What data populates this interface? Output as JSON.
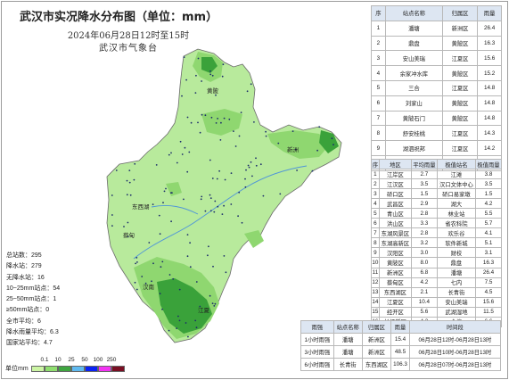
{
  "title": "武汉市实况降水分布图（单位：mm）",
  "subtitle": "2024年06月28日12时至15时",
  "org": "武汉市气象台",
  "stats": [
    "总站数：295",
    "降水站：279",
    "无降水站：16",
    "10~25mm站点：54",
    "25~50mm站点：1",
    "≥50mm站点：0",
    "全市平均：6",
    "降水雨量平均：6.3",
    "国家站平均：4.7"
  ],
  "legend": {
    "unit": "单位mm",
    "ticks": [
      "0.1",
      "10",
      "25",
      "50",
      "100",
      "250"
    ],
    "colors": [
      "#ccf5a4",
      "#8fde6f",
      "#3fa640",
      "#5fbaf0",
      "#0a22f5",
      "#f233f2",
      "#7a0f23"
    ]
  },
  "map": {
    "colors": {
      "light": "#b8ea9c",
      "mid": "#8fd770",
      "dark": "#3aa23a",
      "boundary": "#6b6b6b",
      "river": "#4f95d8"
    },
    "places": [
      "新洲",
      "黄陂",
      "蔡甸",
      "汉南",
      "江夏",
      "东西湖"
    ]
  },
  "top_table": {
    "headers": [
      "序",
      "站点名称",
      "归属区",
      "雨量"
    ],
    "rows": [
      [
        "1",
        "潘塘",
        "新洲区",
        "26.4"
      ],
      [
        "2",
        "鼎盘",
        "黄陂区",
        "16.3"
      ],
      [
        "3",
        "安山美瑞",
        "江夏区",
        "15.6"
      ],
      [
        "4",
        "余家冲水库",
        "黄陂区",
        "15.2"
      ],
      [
        "5",
        "三合",
        "江夏区",
        "14.8"
      ],
      [
        "6",
        "刘家山",
        "黄陂区",
        "14.8"
      ],
      [
        "7",
        "黄陂石门",
        "黄陂区",
        "14.8"
      ],
      [
        "8",
        "舒安桂桃",
        "江夏区",
        "14.3"
      ],
      [
        "9",
        "湖泗祝邦",
        "江夏区",
        "14.2"
      ],
      [
        "10",
        "沿湖",
        "江夏区",
        "14.0"
      ]
    ]
  },
  "district_table": {
    "headers": [
      "序",
      "地区",
      "平均雨量",
      "极值站名",
      "极值雨量"
    ],
    "rows": [
      [
        "1",
        "江岸区",
        "2.7",
        "江滩",
        "3.8"
      ],
      [
        "2",
        "江汉区",
        "3.5",
        "汉口文体中心",
        "3.5"
      ],
      [
        "3",
        "硚口区",
        "1.5",
        "硚口易家墩",
        "1.5"
      ],
      [
        "4",
        "武昌区",
        "2.9",
        "湖大",
        "4.2"
      ],
      [
        "5",
        "青山区",
        "2.8",
        "林业站",
        "5.5"
      ],
      [
        "6",
        "洪山区",
        "3.3",
        "省农科院",
        "5.7"
      ],
      [
        "7",
        "东湖风景区",
        "2.8",
        "欢乐谷",
        "4.1"
      ],
      [
        "8",
        "东湖高新区",
        "3.2",
        "软件新城",
        "5.1"
      ],
      [
        "9",
        "汉阳区",
        "3.0",
        "财校",
        "3.1"
      ],
      [
        "10",
        "黄陂区",
        "8.0",
        "鼎盘",
        "16.3"
      ],
      [
        "11",
        "新洲区",
        "6.8",
        "潘塘",
        "26.4"
      ],
      [
        "12",
        "蔡甸区",
        "4.2",
        "七内",
        "7.5"
      ],
      [
        "13",
        "东西湖区",
        "2.1",
        "长青街",
        "4.5"
      ],
      [
        "14",
        "江夏区",
        "10.4",
        "安山美瑞",
        "15.6"
      ],
      [
        "15",
        "经开区",
        "5.6",
        "武湖湿地",
        "11.5"
      ],
      [
        "16",
        "长江新区",
        "4.3",
        "仓埠",
        "6.6"
      ]
    ]
  },
  "max_table": {
    "headers": [
      "雨强",
      "站点名称",
      "归属区",
      "雨量",
      "时间段"
    ],
    "rows": [
      [
        "1小时雨强",
        "潘塘",
        "新洲区",
        "15.4",
        "06月28日12时-06月28日13时"
      ],
      [
        "3小时雨强",
        "潘塘",
        "新洲区",
        "48.5",
        "06月28日10时-06月28日13时"
      ],
      [
        "6小时雨强",
        "长青街",
        "东西湖区",
        "106.3",
        "06月28日07时-06月28日13时"
      ]
    ]
  }
}
